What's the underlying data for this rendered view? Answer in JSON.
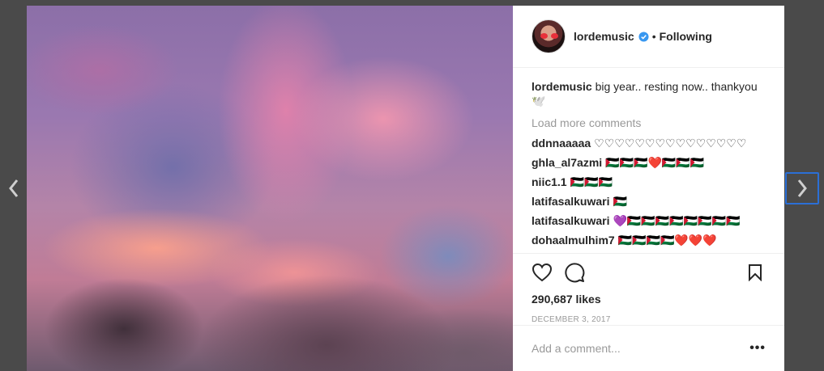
{
  "post": {
    "username": "lordemusic",
    "separator": "•",
    "follow_status": "Following",
    "caption_text": "big year.. resting now.. thankyou 🕊️",
    "load_more": "Load more comments",
    "likes": "290,687 likes",
    "date": "DECEMBER 3, 2017",
    "add_comment_placeholder": "Add a comment...",
    "more_options": "•••"
  },
  "comments": [
    {
      "user": "ddnnaaaaa",
      "text": "♡♡♡♡♡♡♡♡♡♡♡♡♡♡♡"
    },
    {
      "user": "ghla_al7azmi",
      "text": "🇵🇸🇵🇸🇵🇸❤️🇵🇸🇵🇸🇵🇸"
    },
    {
      "user": "niic1.1",
      "text": "🇵🇸🇵🇸🇵🇸"
    },
    {
      "user": "latifasalkuwari",
      "text": "🇵🇸"
    },
    {
      "user": "latifasalkuwari",
      "text": "💜🇵🇸🇵🇸🇵🇸🇵🇸🇵🇸🇵🇸🇵🇸🇵🇸"
    },
    {
      "user": "dohaalmulhim7",
      "text": "🇵🇸🇵🇸🇵🇸🇵🇸❤️❤️❤️"
    }
  ],
  "colors": {
    "verified": "#3897f0",
    "focus_outline": "#2b6fd6"
  },
  "icons": [
    "chevron-left-icon",
    "chevron-right-icon",
    "heart-icon",
    "comment-icon",
    "bookmark-icon",
    "verified-badge-icon"
  ]
}
